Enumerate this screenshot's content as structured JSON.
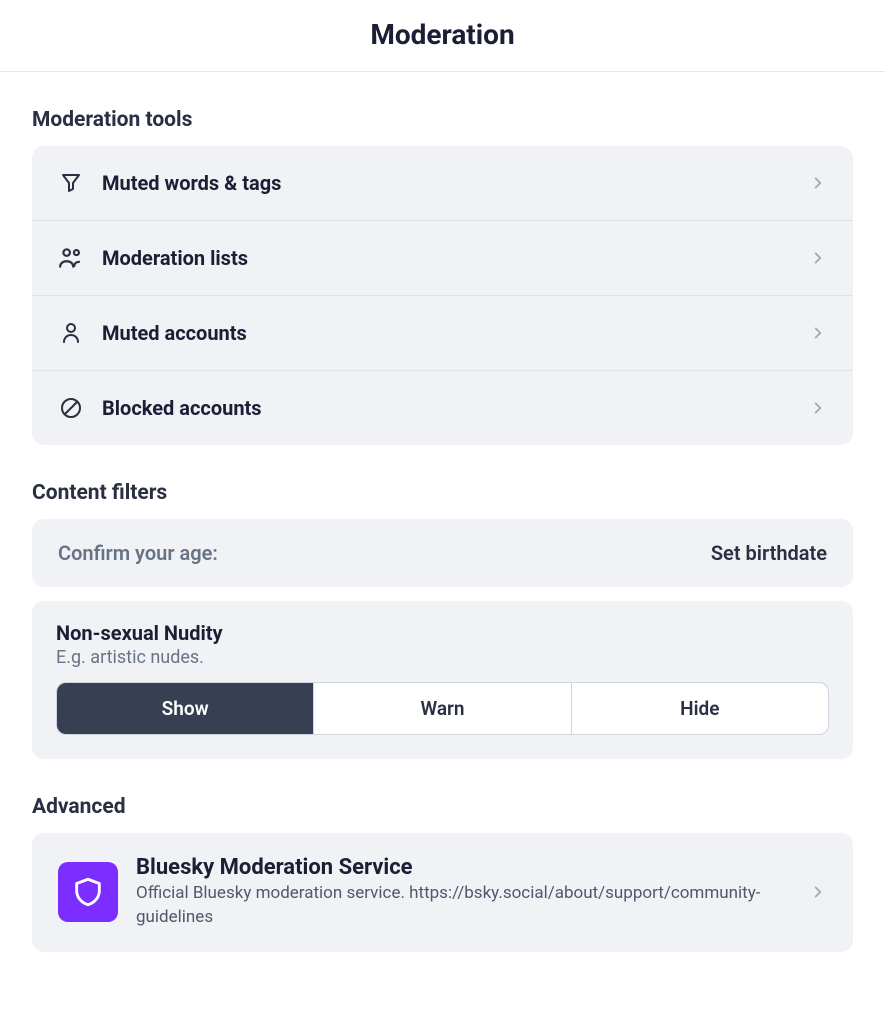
{
  "header": {
    "title": "Moderation"
  },
  "tools": {
    "section_title": "Moderation tools",
    "items": [
      {
        "label": "Muted words & tags"
      },
      {
        "label": "Moderation lists"
      },
      {
        "label": "Muted accounts"
      },
      {
        "label": "Blocked accounts"
      }
    ]
  },
  "filters": {
    "section_title": "Content filters",
    "age": {
      "label": "Confirm your age:",
      "action": "Set birthdate"
    },
    "nudity": {
      "title": "Non-sexual Nudity",
      "desc": "E.g. artistic nudes.",
      "options": {
        "show": "Show",
        "warn": "Warn",
        "hide": "Hide"
      }
    }
  },
  "advanced": {
    "section_title": "Advanced",
    "service": {
      "title": "Bluesky Moderation Service",
      "desc": "Official Bluesky moderation service. https://bsky.social/about/support/community-guidelines"
    }
  }
}
